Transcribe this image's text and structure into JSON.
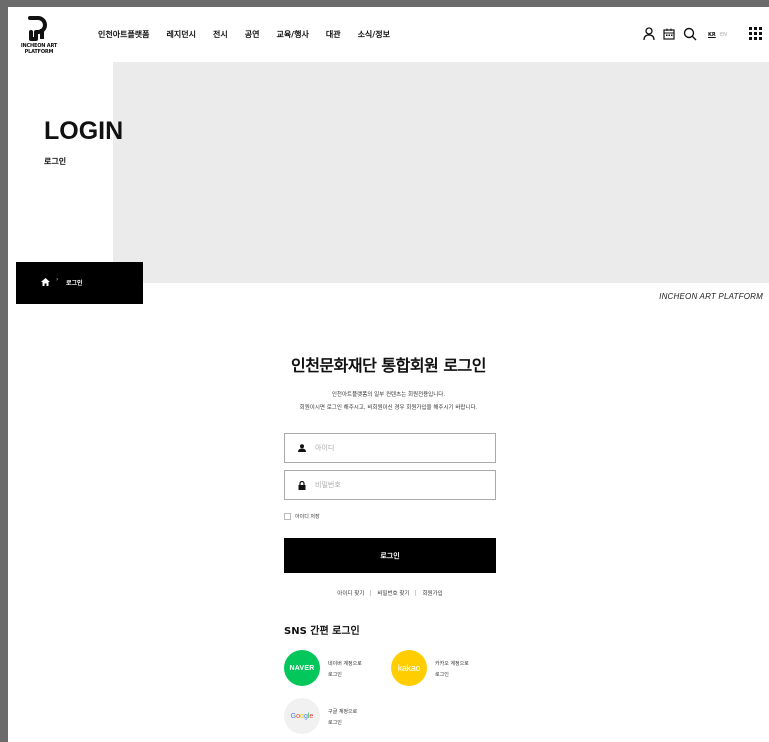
{
  "header": {
    "logo_text": "INCHEON ART\nPLATFORM",
    "nav": [
      "인천아트플랫폼",
      "레지던시",
      "전시",
      "공연",
      "교육/행사",
      "대관",
      "소식/정보"
    ],
    "lang_kr": "KR",
    "lang_en": "EN",
    "icons": [
      "user-icon",
      "calendar-icon",
      "search-icon",
      "grid-menu-icon"
    ]
  },
  "hero": {
    "title": "LOGIN",
    "subtitle": "로그인",
    "breadcrumb_current": "로그인",
    "breadcrumb_sep": "›",
    "brand": "INCHEON ART PLATFORM"
  },
  "login": {
    "title": "인천문화재단 통합회원 로그인",
    "desc_line1": "인천아트플랫폼의 일부 컨텐츠는 회원전용입니다.",
    "desc_line2": "회원이시면 로그인 해주시고, 비회원이신 경우 회원가입을 해주시기 바랍니다.",
    "id_placeholder": "아이디",
    "pw_placeholder": "비밀번호",
    "save_id_label": "아이디 저장",
    "login_button": "로그인",
    "links": [
      "아이디 찾기",
      "비밀번호 찾기",
      "회원가입"
    ]
  },
  "sns": {
    "title": "SNS 간편 로그인",
    "naver": {
      "badge": "NAVER",
      "desc": "네이버 계정으로\n로그인",
      "color": "#03c75a"
    },
    "kakao": {
      "badge": "kakao",
      "desc": "카카오 계정으로\n로그인",
      "color": "#ffcd00"
    },
    "google": {
      "badge": "Google",
      "desc": "구글 계정으로\n로그인",
      "color": "#f1f1f1"
    }
  }
}
